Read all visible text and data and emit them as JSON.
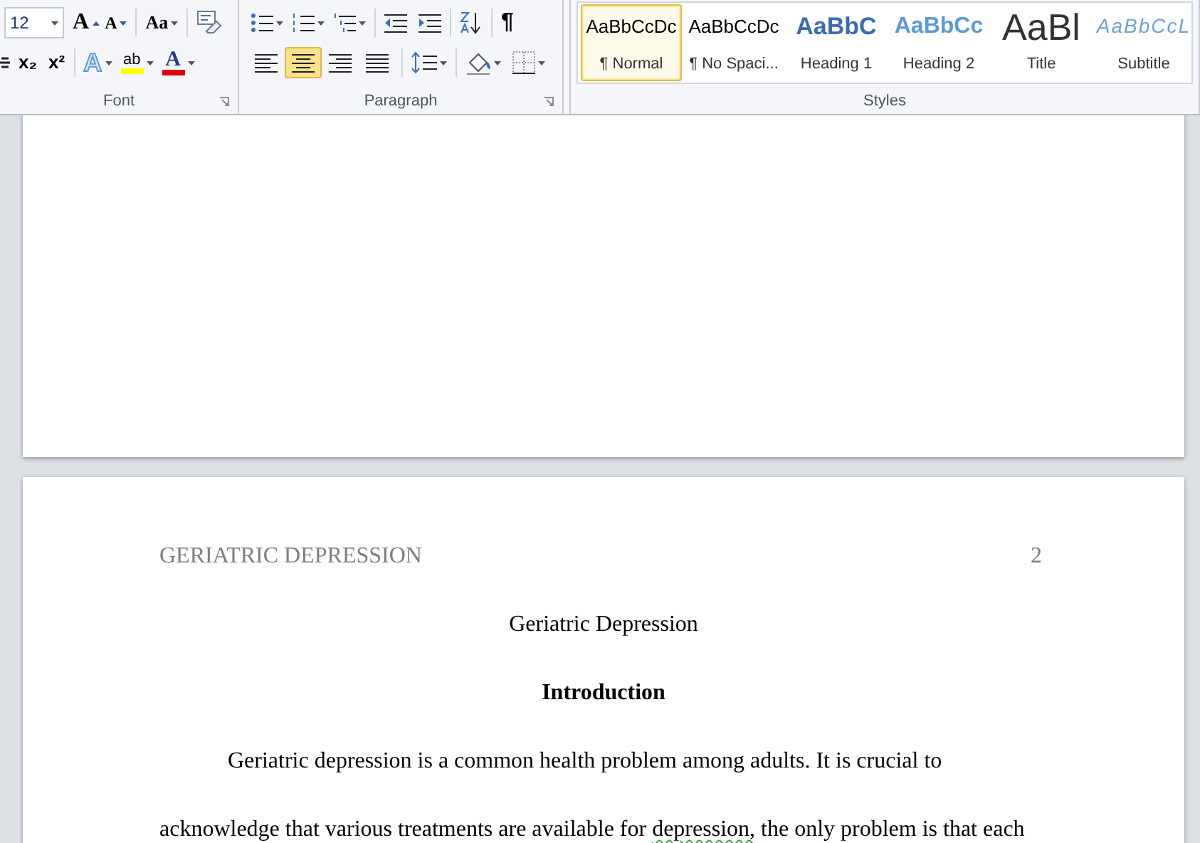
{
  "ribbon": {
    "font_group": {
      "label": "Font",
      "font_size": "12",
      "change_case": "Aa",
      "grow_font": "A",
      "shrink_font": "A",
      "subscript": "x₂",
      "superscript": "x²",
      "text_effects": "A",
      "highlight": "ab",
      "font_color": "A"
    },
    "paragraph_group": {
      "label": "Paragraph",
      "pilcrow": "¶",
      "alignments": [
        {
          "kind": "left",
          "selected": false
        },
        {
          "kind": "center",
          "selected": true
        },
        {
          "kind": "right",
          "selected": false
        },
        {
          "kind": "justify",
          "selected": false
        }
      ]
    },
    "styles_group": {
      "label": "Styles",
      "styles": [
        {
          "kind": "normal",
          "preview": "AaBbCcDc",
          "name": "¶ Normal",
          "selected": true
        },
        {
          "kind": "nospacing",
          "preview": "AaBbCcDc",
          "name": "¶ No Spaci...",
          "selected": false
        },
        {
          "kind": "heading1",
          "preview": "AaBbC",
          "name": "Heading 1",
          "selected": false
        },
        {
          "kind": "heading2",
          "preview": "AaBbCc",
          "name": "Heading 2",
          "selected": false
        },
        {
          "kind": "title",
          "preview": "AaBl",
          "name": "Title",
          "selected": false
        },
        {
          "kind": "subtitle",
          "preview": "AaBbCcL",
          "name": "Subtitle",
          "selected": false
        }
      ]
    }
  },
  "document": {
    "page_2": {
      "running_head": "GERIATRIC DEPRESSION",
      "page_number": "2",
      "title": "Geriatric Depression",
      "heading": "Introduction",
      "paragraph_lines": [
        [
          {
            "text": "Geriatric depression is a common health problem among adults. It is crucial to",
            "flagged": false
          }
        ],
        [
          {
            "text": "acknowledge that various treatments are available for ",
            "flagged": false
          },
          {
            "text": "depression,",
            "flagged": true
          },
          {
            "text": " the only problem is that each",
            "flagged": false
          }
        ]
      ]
    }
  }
}
